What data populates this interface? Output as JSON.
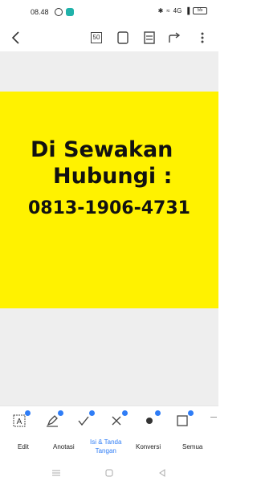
{
  "status_bar": {
    "time": "08.48",
    "signal_text": "4G",
    "battery": "55"
  },
  "toolbar": {
    "back_icon": "chevron-left-icon",
    "page_count": "50",
    "icons": [
      "page-icon",
      "reader-mode-icon",
      "share-icon",
      "more-vertical-icon"
    ]
  },
  "document": {
    "line1": "Di Sewakan",
    "line2": "Hubungi :",
    "line3": "0813-1906-4731",
    "page_color": "#fff200"
  },
  "tools": [
    {
      "icon": "text-box-icon"
    },
    {
      "icon": "pen-icon"
    },
    {
      "icon": "check-icon"
    },
    {
      "icon": "cross-icon"
    },
    {
      "icon": "dot-icon"
    },
    {
      "icon": "square-icon"
    }
  ],
  "tabs": {
    "edit": "Edit",
    "annotate": "Anotasi",
    "fill_sign_1": "Isi & Tanda",
    "fill_sign_2": "Tangan",
    "convert": "Konversi",
    "all": "Semua"
  },
  "colors": {
    "accent": "#2f7df6",
    "background_gray": "#eeeeee"
  }
}
